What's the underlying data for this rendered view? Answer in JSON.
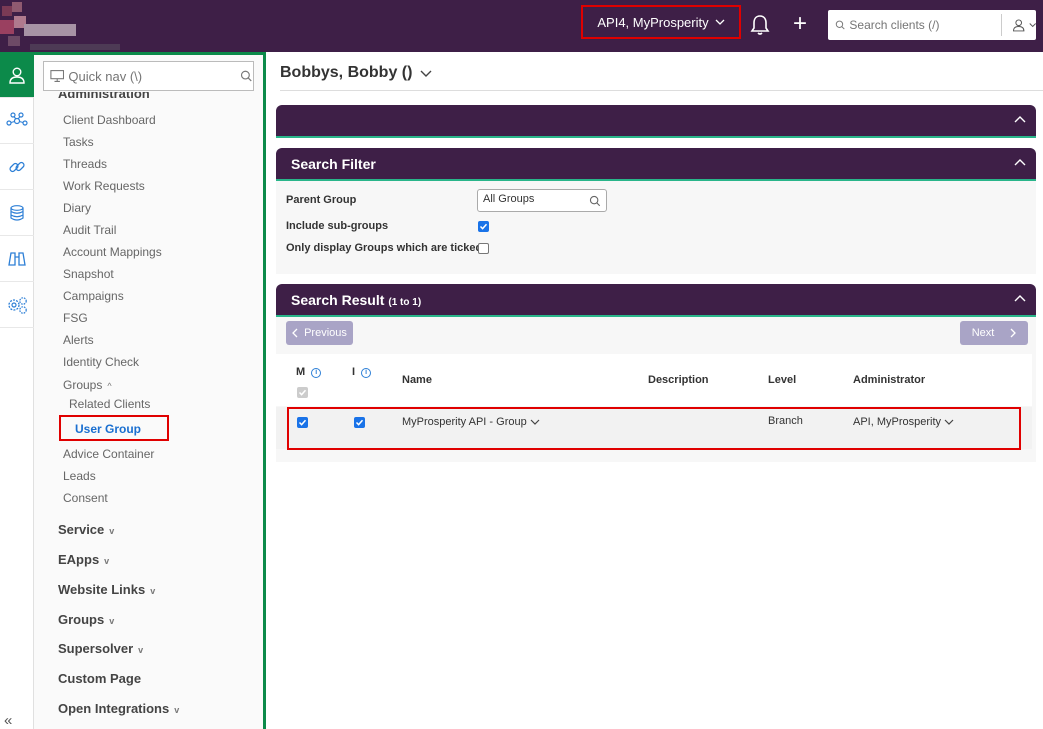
{
  "header": {
    "client_switcher": "API4, MyProsperity",
    "search_placeholder": "Search clients (/)"
  },
  "nav": {
    "quicknav_placeholder": "Quick nav (\\)",
    "cut_section": "Administration",
    "items": [
      "Client Dashboard",
      "Tasks",
      "Threads",
      "Work Requests",
      "Diary",
      "Audit Trail",
      "Account Mappings",
      "Snapshot",
      "Campaigns",
      "FSG",
      "Alerts",
      "Identity Check"
    ],
    "groups_label": "Groups",
    "groups_sub": [
      "Related Clients",
      "User Group"
    ],
    "after_items": [
      "Advice Container",
      "Leads",
      "Consent"
    ],
    "sections": [
      "Service",
      "EApps",
      "Website Links",
      "Groups",
      "Supersolver",
      "Custom Page",
      "Open Integrations"
    ]
  },
  "main": {
    "client_title": "Bobbys, Bobby ()",
    "search_filter": {
      "title": "Search Filter",
      "parent_group_label": "Parent Group",
      "parent_group_value": "All Groups",
      "include_subgroups_label": "Include sub-groups",
      "ticked_only_label": "Only display Groups which are ticked"
    },
    "search_result": {
      "title": "Search Result",
      "range": "(1 to 1)",
      "prev_label": "Previous",
      "next_label": "Next",
      "columns": {
        "m": "M",
        "i": "I",
        "name": "Name",
        "description": "Description",
        "level": "Level",
        "administrator": "Administrator"
      },
      "row": {
        "name": "MyProsperity API - Group",
        "description": "",
        "level": "Branch",
        "administrator": "API, MyProsperity"
      }
    }
  },
  "colors": {
    "brand": "#3e1f47",
    "accent": "#0c8a4a",
    "highlight": "#e00000",
    "link": "#1a6fd0"
  }
}
